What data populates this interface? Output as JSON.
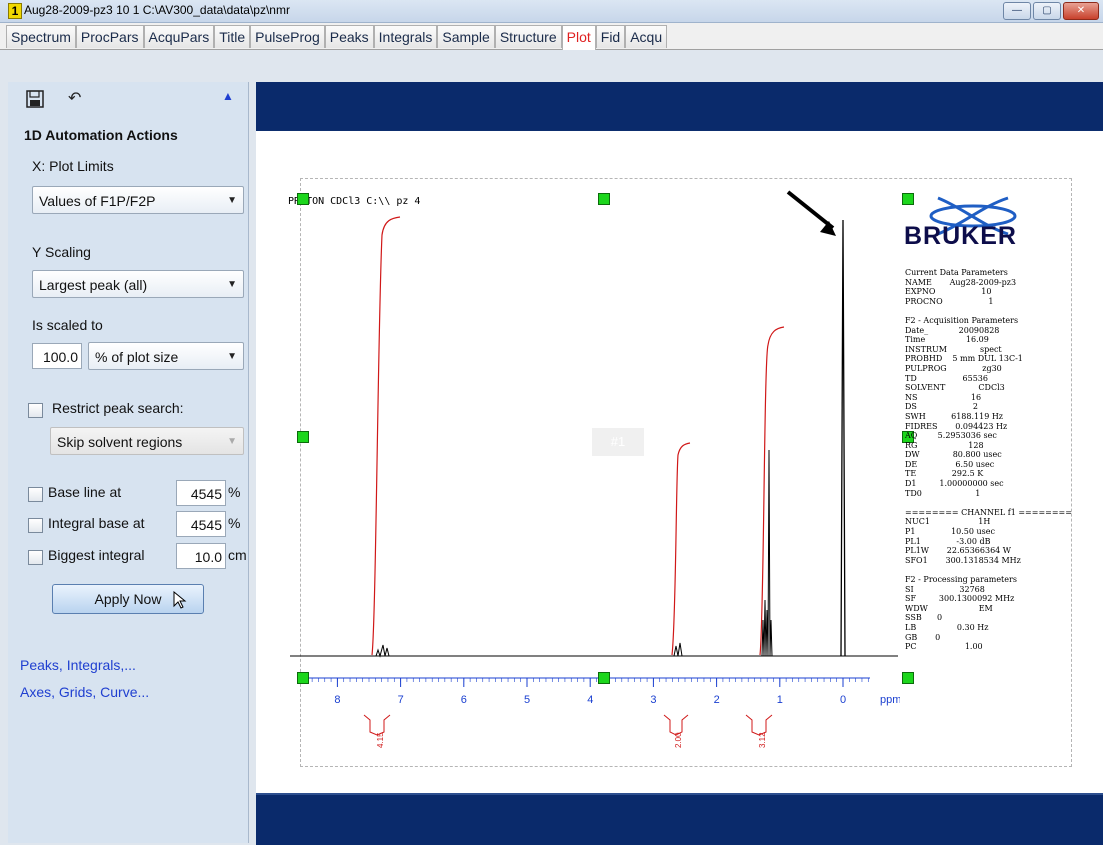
{
  "window": {
    "number": "1",
    "title": "Aug28-2009-pz3  10  1  C:\\AV300_data\\data\\pz\\nmr",
    "buttons": {
      "minimize": "—",
      "maximize": "▢",
      "close": "✕"
    }
  },
  "tabs": [
    "Spectrum",
    "ProcPars",
    "AcquPars",
    "Title",
    "PulseProg",
    "Peaks",
    "Integrals",
    "Sample",
    "Structure",
    "Plot",
    "Fid",
    "Acqu"
  ],
  "active_tab": "Plot",
  "left_panel": {
    "toolbar": {
      "save_icon": "floppy-icon",
      "undo_icon": "undo-icon",
      "collapse_icon": "triangle-up-icon"
    },
    "section_title": "1D Automation Actions",
    "x_label": "X: Plot Limits",
    "x_dropdown": "Values of F1P/F2P",
    "y_label": "Y Scaling",
    "y_dropdown": "Largest peak (all)",
    "scaled_label": "Is scaled to",
    "scaled_value": "100.0",
    "scaled_unit_dropdown": "% of plot size",
    "restrict_label": "Restrict peak search:",
    "solvent_dropdown": "Skip solvent regions",
    "baseline_label": "Base line at",
    "baseline_value": "4545",
    "baseline_unit": "%",
    "integral_base_label": "Integral base at",
    "integral_base_value": "4545",
    "integral_base_unit": "%",
    "biggest_integral_label": "Biggest integral",
    "biggest_integral_value": "10.0",
    "biggest_integral_unit": "cm",
    "apply_button": "Apply Now",
    "link_peaks": "Peaks, Integrals,...",
    "link_axes": "Axes, Grids, Curve..."
  },
  "plot": {
    "header_label": "PROTON CDCl3 C:\\\\ pz 4",
    "watermark": "#1",
    "logo_text": "BRUKER",
    "axis_unit": "ppm",
    "axis_ticks": [
      "8",
      "7",
      "6",
      "5",
      "4",
      "3",
      "2",
      "1",
      "0"
    ],
    "integrals": [
      "4.15",
      "2.00",
      "3.12"
    ],
    "params": [
      "Current Data Parameters",
      "NAME       Aug28-2009-pz3",
      "EXPNO                  10",
      "PROCNO                  1",
      "",
      "F2 - Acquisition Parameters",
      "Date_            20090828",
      "Time                16.09",
      "INSTRUM             spect",
      "PROBHD    5 mm DUL 13C-1",
      "PULPROG              zg30",
      "TD                  65536",
      "SOLVENT             CDCl3",
      "NS                     16",
      "DS                      2",
      "SWH          6188.119 Hz",
      "FIDRES       0.094423 Hz",
      "AQ        5.2953036 sec",
      "RG                    128",
      "DW             80.800 usec",
      "DE               6.50 usec",
      "TE              292.5 K",
      "D1         1.00000000 sec",
      "TD0                     1",
      "",
      "======== CHANNEL f1 ========",
      "NUC1                   1H",
      "P1              10.50 usec",
      "PL1              -3.00 dB",
      "PL1W       22.65366364 W",
      "SFO1       300.1318534 MHz",
      "",
      "F2 - Processing parameters",
      "SI                  32768",
      "SF         300.1300092 MHz",
      "WDW                    EM",
      "SSB      0",
      "LB                0.30 Hz",
      "GB       0",
      "PC                   1.00"
    ]
  }
}
